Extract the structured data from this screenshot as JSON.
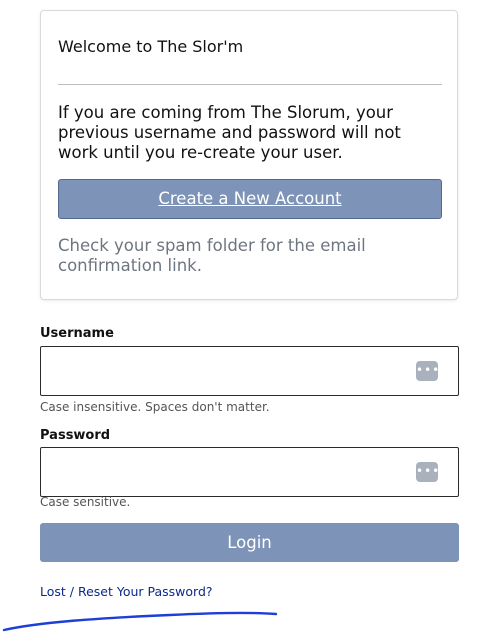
{
  "welcome": {
    "title": "Welcome to The Slor'm",
    "message": "If you are coming from The Slorum, your previous username and password will not work until you re-create your user.",
    "create_account_label": "Create a New Account",
    "spam_note": "Check your spam folder for the email confirmation link."
  },
  "login_form": {
    "username": {
      "label": "Username",
      "value": "",
      "help": "Case insensitive. Spaces don't matter."
    },
    "password": {
      "label": "Password",
      "value": "",
      "help": "Case sensitive."
    },
    "password_manager_icon": "password-manager-dots-icon",
    "login_label": "Login",
    "reset_link_label": "Lost / Reset Your Password?"
  },
  "colors": {
    "button_bg": "#7d93b7",
    "link": "#0b2a8a",
    "pen_stroke": "#1e3fd6"
  }
}
